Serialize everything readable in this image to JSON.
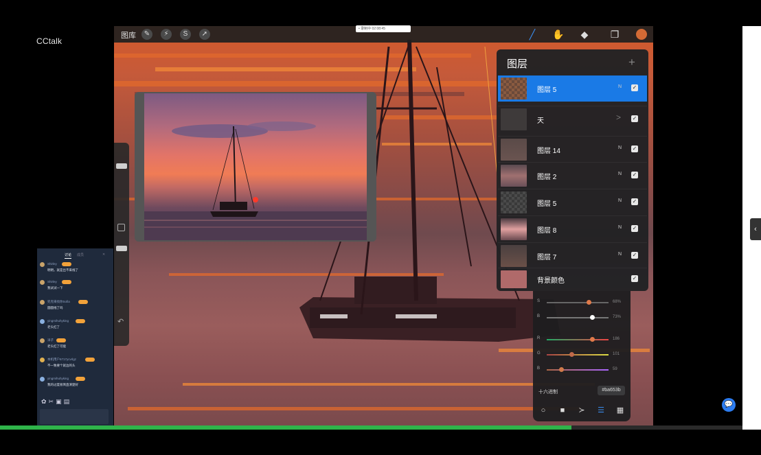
{
  "app": {
    "name": "CCtalk"
  },
  "procreate": {
    "gallery_label": "图库",
    "left_tools": [
      "wrench-icon",
      "magic-wand-icon",
      "selection-icon",
      "transform-arrow-icon"
    ],
    "right_tools": [
      "brush-icon",
      "smudge-icon",
      "eraser-icon",
      "layers-icon",
      "color-swatch"
    ],
    "current_color": "#ba653b"
  },
  "recording_badge": "• 录制中 02:08:45",
  "chat": {
    "tabs": [
      "讨论",
      "成员"
    ],
    "messages": [
      {
        "name": "Shirley",
        "text": "明明，就是出不来线了"
      },
      {
        "name": "Shirley",
        "text": "我试试一下"
      },
      {
        "name": "兜兜来找你Sofia",
        "text": "圆圆线了吗"
      },
      {
        "name": "yingmihuhyking",
        "text": "老头红了"
      },
      {
        "name": "洋子",
        "text": "老头红了可能"
      },
      {
        "name": "本机用户6717ycvrlgz",
        "text": "不一致要个就边的头"
      },
      {
        "name": "yingmihuhyking",
        "text": "我的过度很简直清楚好"
      }
    ]
  },
  "layers_panel": {
    "title": "图层",
    "add_label": "+",
    "layers": [
      {
        "name": "图层 5",
        "mode": "N",
        "visible": true,
        "active": true
      },
      {
        "name": "天",
        "mode": ">",
        "visible": true,
        "active": false,
        "group": true
      },
      {
        "name": "图层 14",
        "mode": "N",
        "visible": true,
        "active": false
      },
      {
        "name": "图层 2",
        "mode": "N",
        "visible": true,
        "active": false
      },
      {
        "name": "图层 5",
        "mode": "N",
        "visible": true,
        "active": false
      },
      {
        "name": "图层 8",
        "mode": "N",
        "visible": true,
        "active": false
      },
      {
        "name": "图层 7",
        "mode": "N",
        "visible": true,
        "active": false
      },
      {
        "name": "背景颜色",
        "mode": "",
        "visible": true,
        "active": false
      }
    ]
  },
  "color_panel": {
    "sliders": [
      {
        "label": "S",
        "value": "68%",
        "fraction": 0.68,
        "track": "#666",
        "knob": "#e07a4a"
      },
      {
        "label": "B",
        "value": "73%",
        "fraction": 0.73,
        "track": "#777",
        "knob": "#ffffff"
      },
      {
        "label": "R",
        "value": "186",
        "fraction": 0.73,
        "track": "linear-gradient(90deg,#2a6,#e44)",
        "knob": "#e07a4a"
      },
      {
        "label": "G",
        "value": "101",
        "fraction": 0.4,
        "track": "linear-gradient(90deg,#a44,#dd4)",
        "knob": "#c26a4a"
      },
      {
        "label": "B",
        "value": "59",
        "fraction": 0.23,
        "track": "linear-gradient(90deg,#a64,#a6f)",
        "knob": "#d07a4a"
      }
    ],
    "hex_label": "十六进制",
    "hex_value": "#ba653b"
  },
  "progress": {
    "fraction": 0.77
  }
}
